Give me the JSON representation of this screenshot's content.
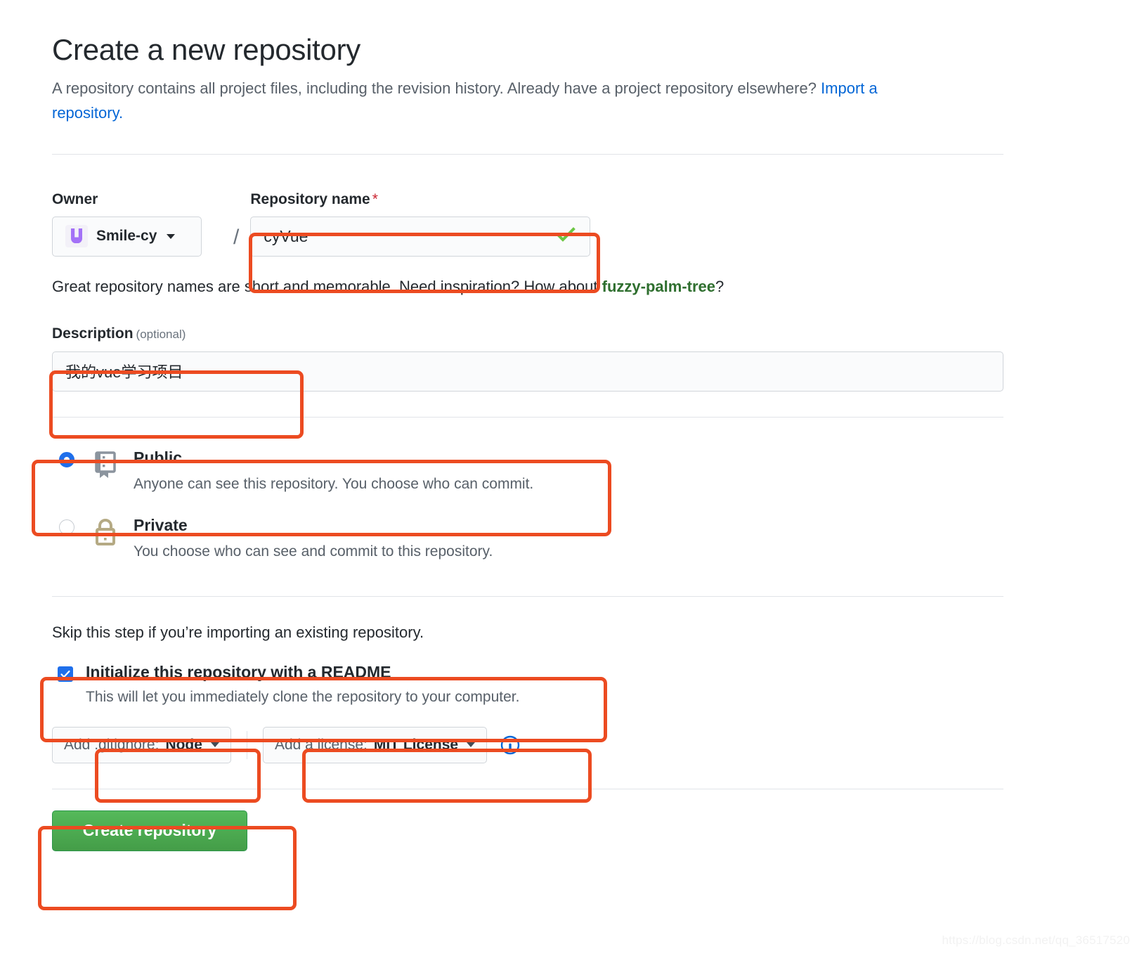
{
  "header": {
    "title": "Create a new repository",
    "subtitle_part1": "A repository contains all project files, including the revision history. Already have a project repository elsewhere?",
    "import_link": "Import a repository."
  },
  "owner": {
    "label": "Owner",
    "name": "Smile-cy",
    "avatar_letter": "U",
    "avatar_color": "#a371f7",
    "caret": "chevron-down-icon"
  },
  "separator": "/",
  "repository_name": {
    "label": "Repository name",
    "required_marker": "*",
    "value": "cyVue",
    "placeholder": "",
    "valid_icon": "check-icon",
    "valid_color": "#6cc644"
  },
  "name_hint": {
    "prefix": "Great repository names are short and memorable. Need inspiration? How about",
    "suggestion": "fuzzy-palm-tree",
    "suffix": "?"
  },
  "description": {
    "label": "Description",
    "optional": "(optional)",
    "value": "我的vue学习项目",
    "placeholder": ""
  },
  "visibility": {
    "options": [
      {
        "id": "public",
        "title": "Public",
        "desc": "Anyone can see this repository. You choose who can commit.",
        "icon": "book-icon",
        "icon_color": "#8b949e",
        "selected": true
      },
      {
        "id": "private",
        "title": "Private",
        "desc": "You choose who can see and commit to this repository.",
        "icon": "lock-icon",
        "icon_color": "#b5aa84",
        "selected": false
      }
    ]
  },
  "initialize": {
    "skip_note": "Skip this step if you’re importing an existing repository.",
    "readme_label": "Initialize this repository with a README",
    "readme_desc": "This will let you immediately clone the repository to your computer.",
    "readme_checked": true,
    "gitignore": {
      "prefix": "Add .gitignore:",
      "value": "Node",
      "caret": "chevron-down-icon"
    },
    "license": {
      "prefix": "Add a license:",
      "value": "MIT License",
      "caret": "chevron-down-icon"
    },
    "info_icon": "info-icon",
    "info_icon_color": "#0366d6"
  },
  "submit": {
    "label": "Create repository",
    "color": "#2c974b"
  },
  "annotation_color": "#ec4b21",
  "watermark": "https://blog.csdn.net/qq_36517520"
}
